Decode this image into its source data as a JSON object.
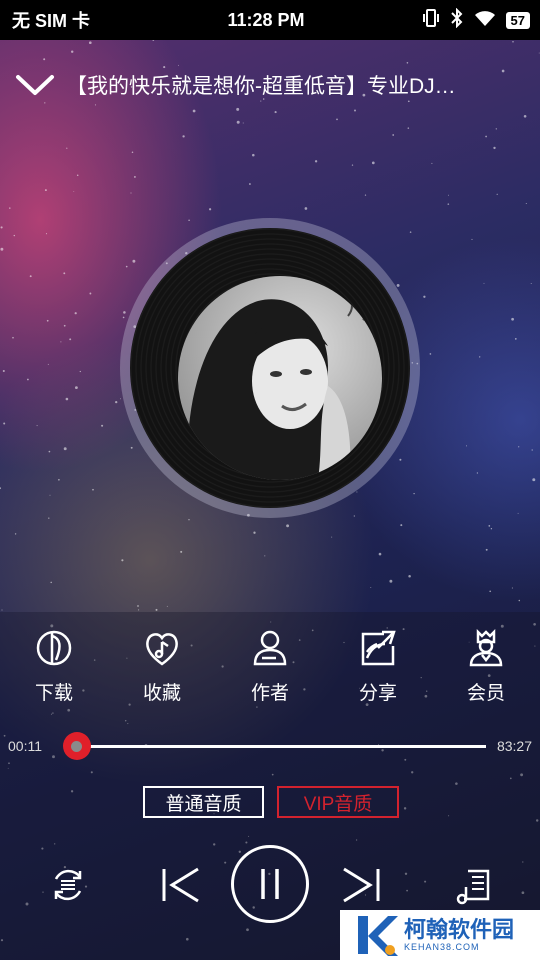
{
  "status_bar": {
    "carrier": "无 SIM 卡",
    "time": "11:28 PM",
    "battery": "57"
  },
  "header": {
    "title": "【我的快乐就是想你-超重低音】专业DJ…"
  },
  "actions": [
    {
      "label": "下载",
      "icon": "download-icon"
    },
    {
      "label": "收藏",
      "icon": "favorite-heart-icon"
    },
    {
      "label": "作者",
      "icon": "author-person-icon"
    },
    {
      "label": "分享",
      "icon": "share-icon"
    },
    {
      "label": "会员",
      "icon": "vip-member-icon"
    }
  ],
  "progress": {
    "current": "00:11",
    "total": "83:27",
    "fraction": 0.0022
  },
  "quality": {
    "normal": "普通音质",
    "vip": "VIP音质"
  },
  "controls": {
    "mode_icon": "repeat-mode-icon",
    "prev_icon": "previous-icon",
    "play_icon": "pause-icon",
    "next_icon": "next-icon",
    "playlist_icon": "playlist-icon"
  },
  "watermark": {
    "title": "柯翰软件园",
    "subtitle": "KEHAN38.COM"
  },
  "colors": {
    "accent_red": "#e0202a",
    "vip_red": "#d3222e",
    "watermark_blue": "#1f62b8"
  }
}
